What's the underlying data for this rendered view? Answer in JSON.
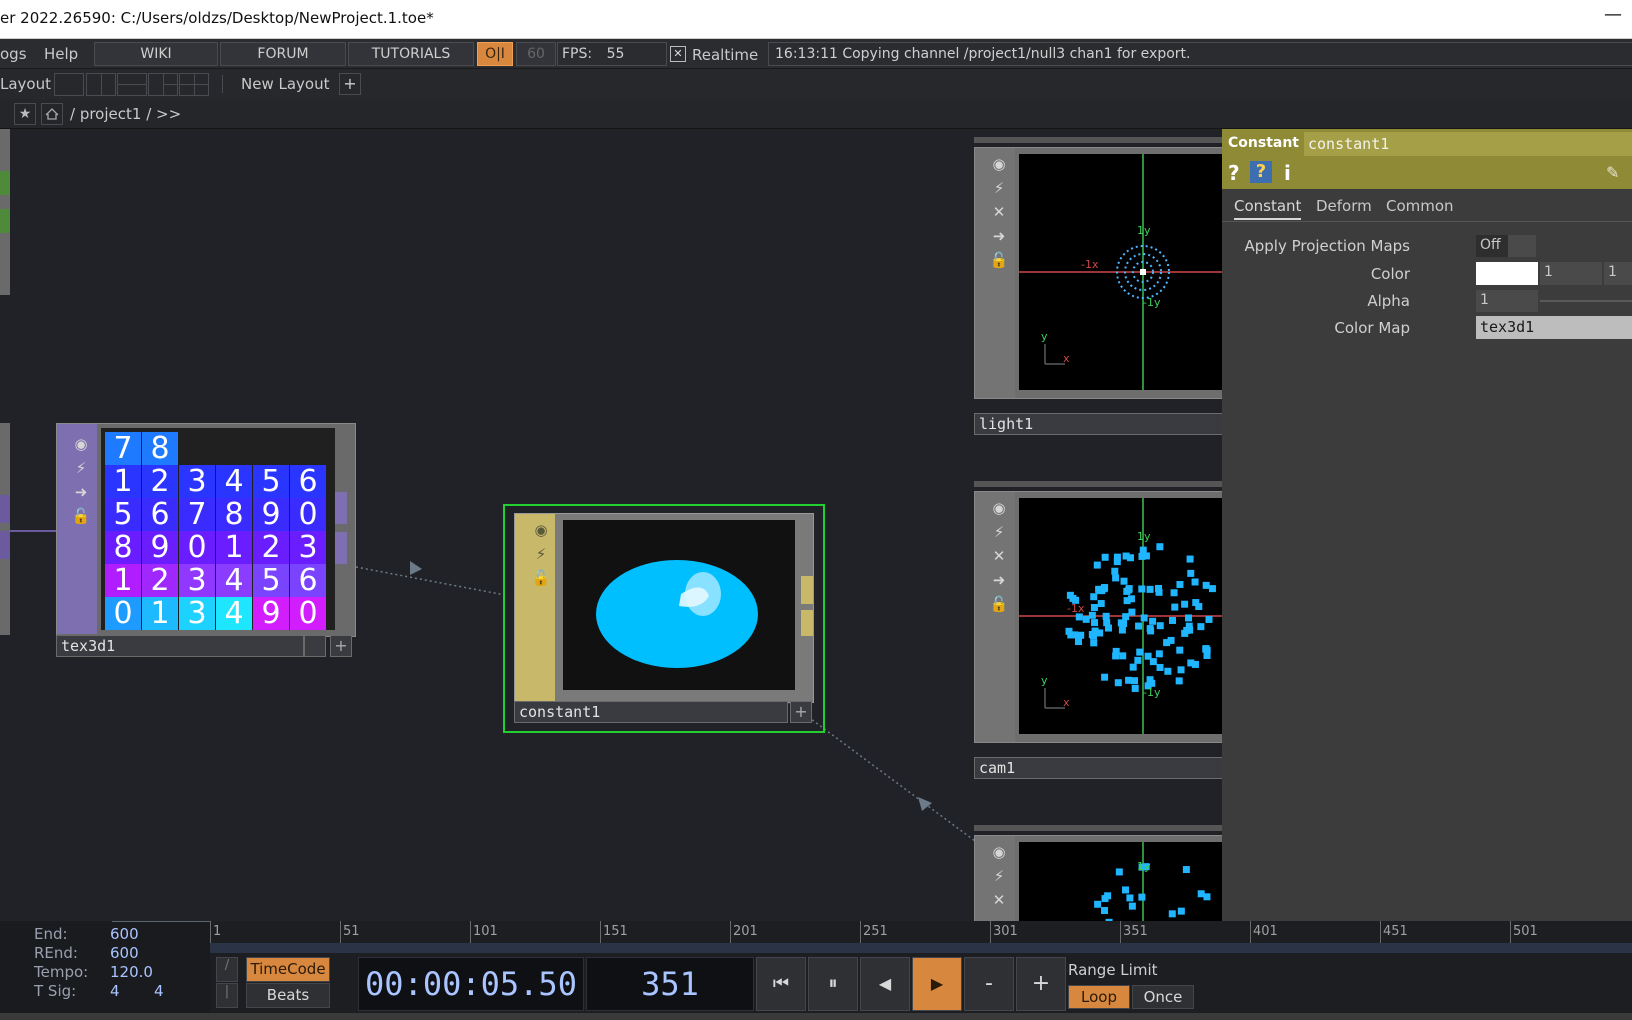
{
  "window": {
    "title": "er 2022.26590: C:/Users/oldzs/Desktop/NewProject.1.toe*",
    "minimize_glyph": "—"
  },
  "menubar": {
    "menu_logs": "ogs",
    "menu_help": "Help",
    "wiki": "WIKI",
    "forum": "FORUM",
    "tutorials": "TUTORIALS",
    "oi": "O|I",
    "fps_cap": "60",
    "fps_label": "FPS:",
    "fps_value": "55",
    "realtime_check": "✕",
    "realtime_label": "Realtime",
    "status": "16:13:11 Copying channel /project1/null3 chan1 for export."
  },
  "layoutbar": {
    "layout_label": "Layout",
    "new_layout": "New Layout",
    "add": "+"
  },
  "pathbar": {
    "path": "/ project1 / >>"
  },
  "nodes": {
    "tex3d1": {
      "name": "tex3d1",
      "rows": [
        [
          "7",
          "8",
          "",
          "",
          "",
          ""
        ],
        [
          "1",
          "2",
          "3",
          "4",
          "5",
          "6"
        ],
        [
          "5",
          "6",
          "7",
          "8",
          "9",
          "0"
        ],
        [
          "8",
          "9",
          "0",
          "1",
          "2",
          "3"
        ],
        [
          "1",
          "2",
          "3",
          "4",
          "5",
          "6"
        ],
        [
          "0",
          "1",
          "3",
          "4",
          "9",
          "0"
        ]
      ]
    },
    "constant1": {
      "name": "constant1"
    },
    "light1": {
      "name": "light1",
      "label_1y": "1y",
      "label_neg1x": "-1x",
      "label_neg1y": "-1y",
      "axis_y": "y",
      "axis_x": "x"
    },
    "cam1": {
      "name": "cam1",
      "label_1y": "1y",
      "label_neg1x": "-1x",
      "label_neg1y": "-1y",
      "axis_y": "y",
      "axis_x": "x"
    },
    "third": {
      "label_1y": "1y"
    }
  },
  "params": {
    "op_type": "Constant",
    "op_name": "constant1",
    "help_icon": "?",
    "python_help_icon": "?",
    "info_icon": "i",
    "tabs": [
      "Constant",
      "Deform",
      "Common"
    ],
    "apply_projection_maps_label": "Apply Projection Maps",
    "apply_projection_maps_value": "Off",
    "color_label": "Color",
    "color_g": "1",
    "color_b": "1",
    "alpha_label": "Alpha",
    "alpha_value": "1",
    "color_map_label": "Color Map",
    "color_map_value": "tex3d1"
  },
  "timeline": {
    "end_label": "End:",
    "end_value": "600",
    "rend_label": "REnd:",
    "rend_value": "600",
    "tempo_label": "Tempo:",
    "tempo_value": "120.0",
    "tsig_label": "T Sig:",
    "tsig_a": "4",
    "tsig_b": "4",
    "ruler": [
      "1",
      "51",
      "101",
      "151",
      "201",
      "251",
      "301",
      "351",
      "401",
      "451",
      "501"
    ],
    "timecode_btn": "TimeCode",
    "beats_btn": "Beats",
    "timecode": "00:00:05.50",
    "frame": "351",
    "btn_start": "⏮",
    "btn_pause": "⏸",
    "btn_back": "◀",
    "btn_play": "▶",
    "btn_minus": "-",
    "btn_plus": "+",
    "range_limit": "Range Limit",
    "loop": "Loop",
    "once": "Once"
  },
  "colors": {
    "accent_orange": "#d8883e",
    "selected_green": "#22d030",
    "param_header": "#8f8a36",
    "sphere_blue": "#00bfff"
  }
}
